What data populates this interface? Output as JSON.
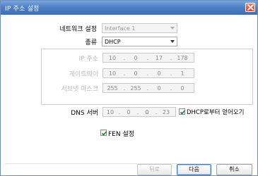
{
  "window": {
    "title": "IP 주소 설정"
  },
  "network_setting": {
    "label": "네트워크 설정",
    "value": "Interface 1"
  },
  "type": {
    "label": "종류",
    "value": "DHCP"
  },
  "ip_address": {
    "label": "IP 주소",
    "octets": [
      "10",
      "0",
      "17",
      "178"
    ]
  },
  "gateway": {
    "label": "게이트웨이",
    "octets": [
      "10",
      "0",
      "0",
      "1"
    ]
  },
  "subnet_mask": {
    "label": "서브넷 마스크",
    "octets": [
      "255",
      "255",
      "0",
      "0"
    ]
  },
  "dns_server": {
    "label": "DNS 서버",
    "octets": [
      "10",
      "0",
      "0",
      "23"
    ]
  },
  "dhcp_checkbox": {
    "label": "DHCP로부터 얻어오기",
    "checked": true
  },
  "fen_checkbox": {
    "label": "FEN 설정",
    "checked": true
  },
  "buttons": {
    "back": "뒤로",
    "next": "다음",
    "cancel": "취소"
  },
  "colors": {
    "title_bar": "#4f81c7",
    "close_button": "#d9452b",
    "default_button_border": "#3c7fc8"
  },
  "icons": {
    "close": "close-x-icon",
    "checkmark": "checkmark-icon",
    "dropdown": "chevron-down-icon"
  }
}
